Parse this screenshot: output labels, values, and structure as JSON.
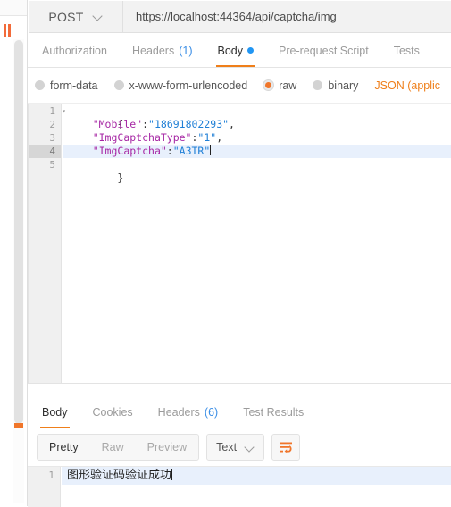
{
  "request": {
    "method": "POST",
    "url": "https://localhost:44364/api/captcha/img",
    "tabs": [
      {
        "label": "Authorization",
        "count": "",
        "dot": false,
        "active": false
      },
      {
        "label": "Headers",
        "count": "(1)",
        "dot": false,
        "active": false
      },
      {
        "label": "Body",
        "count": "",
        "dot": true,
        "active": true
      },
      {
        "label": "Pre-request Script",
        "count": "",
        "dot": false,
        "active": false
      },
      {
        "label": "Tests",
        "count": "",
        "dot": false,
        "active": false
      }
    ],
    "body_types": [
      {
        "label": "form-data",
        "checked": false
      },
      {
        "label": "x-www-form-urlencoded",
        "checked": false
      },
      {
        "label": "raw",
        "checked": true
      },
      {
        "label": "binary",
        "checked": false
      }
    ],
    "content_type": "JSON (applic",
    "editor": {
      "lines": [
        {
          "num": "1",
          "fold": true,
          "highlight": false,
          "text": "{"
        },
        {
          "num": "2",
          "fold": false,
          "highlight": false,
          "key": "\"Mobile\"",
          "colon": ":",
          "value": "\"18691802293\"",
          "tail": ","
        },
        {
          "num": "3",
          "fold": false,
          "highlight": false,
          "key": "\"ImgCaptchaType\"",
          "colon": ":",
          "value": "\"1\"",
          "tail": ","
        },
        {
          "num": "4",
          "fold": false,
          "highlight": true,
          "key": "\"ImgCaptcha\"",
          "colon": ":",
          "value": "\"A3TR\"",
          "tail": "",
          "caret": true
        },
        {
          "num": "5",
          "fold": false,
          "highlight": false,
          "text": "}"
        }
      ]
    }
  },
  "response": {
    "tabs": [
      {
        "label": "Body",
        "count": "",
        "active": true
      },
      {
        "label": "Cookies",
        "count": "",
        "active": false
      },
      {
        "label": "Headers",
        "count": "(6)",
        "active": false
      },
      {
        "label": "Test Results",
        "count": "",
        "active": false
      }
    ],
    "view_modes": [
      {
        "label": "Pretty",
        "active": true
      },
      {
        "label": "Raw",
        "active": false
      },
      {
        "label": "Preview",
        "active": false
      }
    ],
    "format": "Text",
    "wrap_icon": "word-wrap-icon",
    "body_lines": [
      {
        "num": "1",
        "text": "图形验证码验证成功"
      }
    ]
  },
  "colors": {
    "accent_orange": "#ef7f1a",
    "tab_dot_blue": "#2196f3",
    "count_blue": "#3a8ee6",
    "json_key": "#a626a4",
    "json_string": "#1f7fd6",
    "line_highlight": "#e8f0fc"
  }
}
